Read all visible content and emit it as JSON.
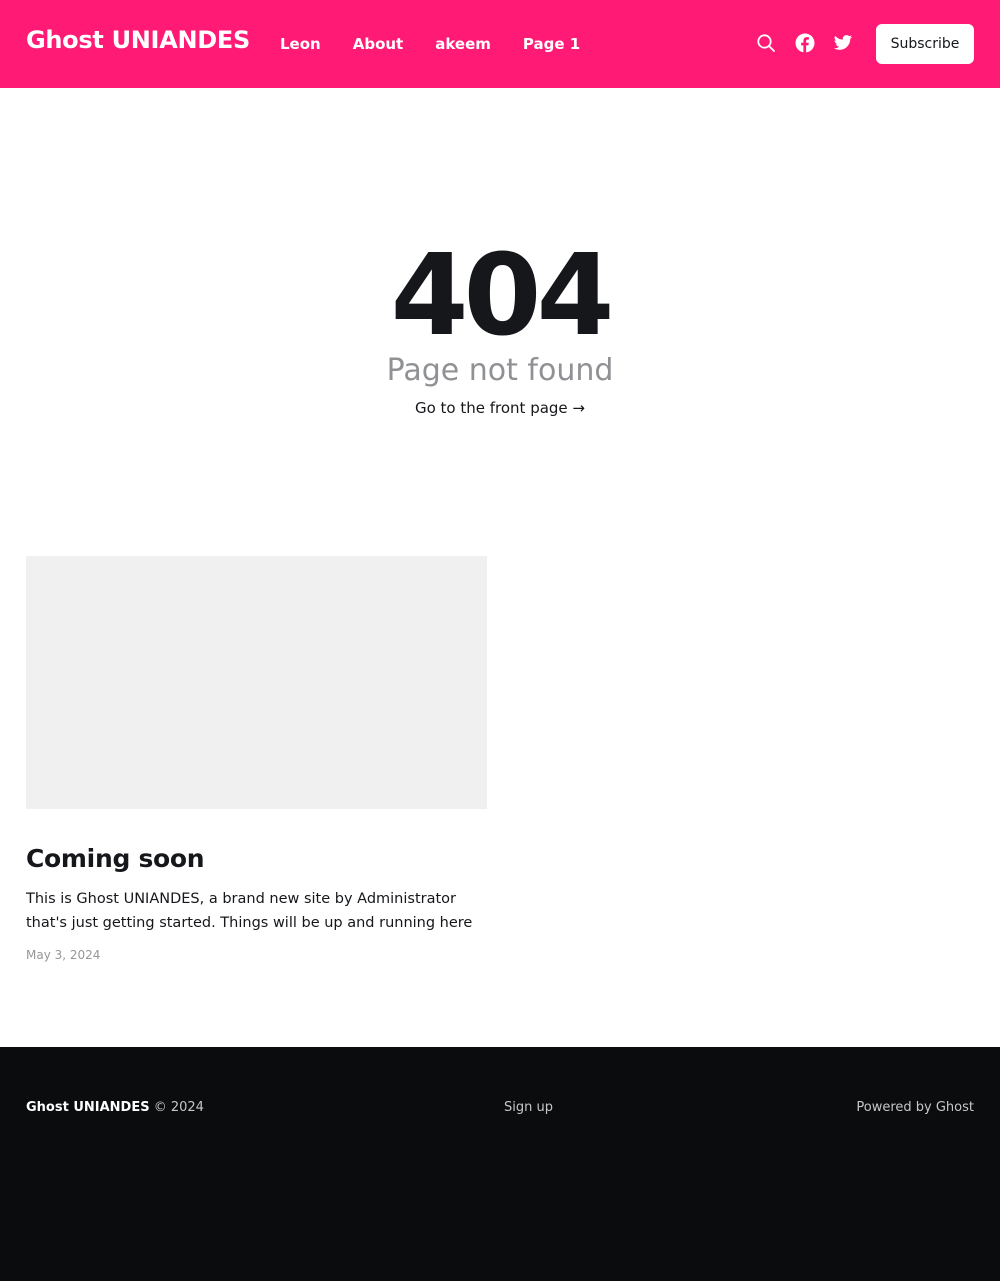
{
  "header": {
    "site_title": "Ghost UNIANDES",
    "nav": [
      {
        "label": "Leon"
      },
      {
        "label": "About"
      },
      {
        "label": "akeem"
      },
      {
        "label": "Page 1"
      }
    ],
    "icons": [
      "search-icon",
      "facebook-icon",
      "twitter-icon"
    ],
    "subscribe_label": "Subscribe",
    "background_color": "#ff1a75"
  },
  "error": {
    "code": "404",
    "message": "Page not found",
    "link_text": "Go to the front page →"
  },
  "posts": [
    {
      "title": "Coming soon",
      "excerpt": "This is Ghost UNIANDES, a brand new site by Administrator that's just getting started. Things will be up and running here shortly,...",
      "date": "May 3, 2024"
    }
  ],
  "footer": {
    "site_title": "Ghost UNIANDES",
    "copyright": "© 2024",
    "signup_label": "Sign up",
    "powered_label": "Powered by Ghost",
    "background_color": "#0b0c0e"
  }
}
